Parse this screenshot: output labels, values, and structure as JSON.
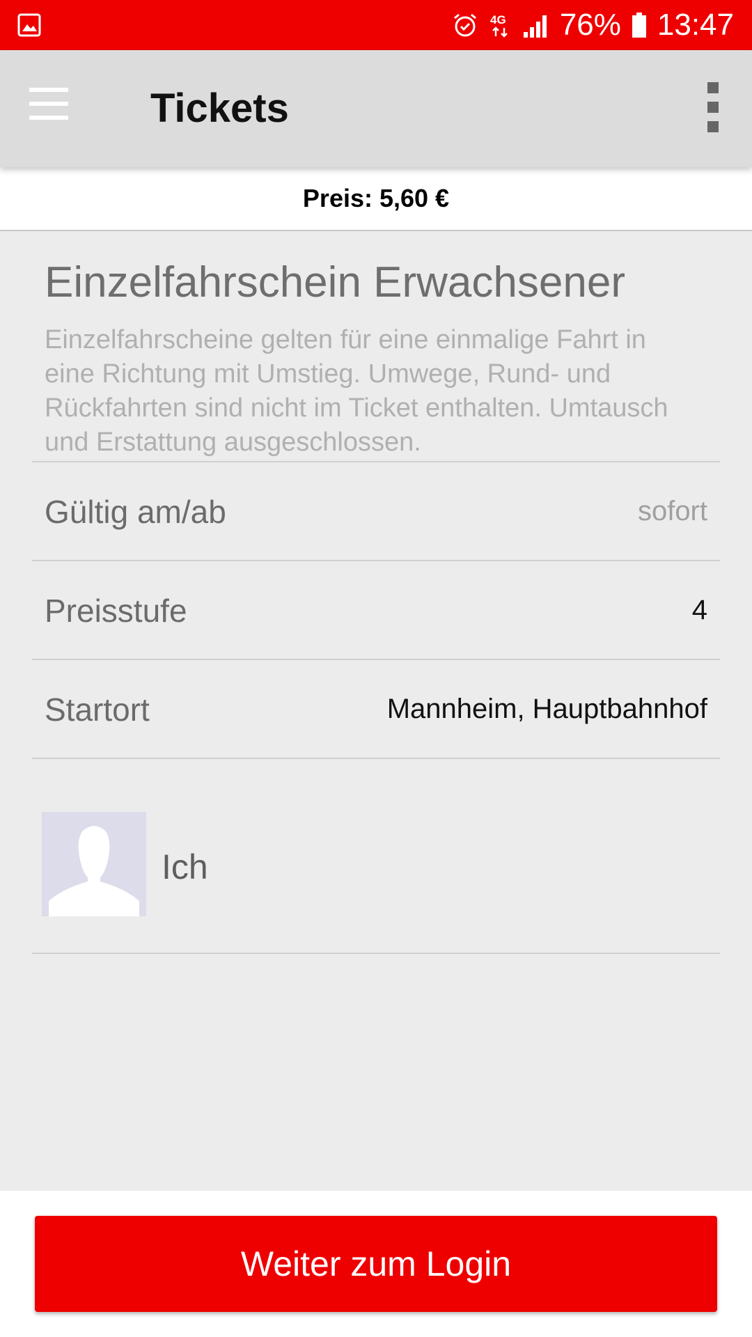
{
  "status_bar": {
    "battery_percent": "76%",
    "time": "13:47",
    "network": "4G",
    "icons": [
      "image-icon",
      "alarm-icon",
      "network-4g-icon",
      "signal-icon",
      "battery-icon"
    ]
  },
  "app_bar": {
    "title": "Tickets",
    "icons": [
      "hamburger-menu-icon",
      "overflow-menu-icon"
    ]
  },
  "price_bar": {
    "text": "Preis: 5,60 €"
  },
  "ticket": {
    "title": "Einzelfahrschein Erwachsener",
    "description": "Einzelfahrscheine gelten für eine einmalige Fahrt in eine Richtung mit Umstieg. Umwege, Rund- und Rückfahrten sind nicht im Ticket enthalten. Umtausch und Erstattung ausgeschlossen."
  },
  "rows": [
    {
      "label": "Gültig am/ab",
      "value": "sofort"
    },
    {
      "label": "Preisstufe",
      "value": "4"
    },
    {
      "label": "Startort",
      "value": "Mannheim, Hauptbahnhof"
    }
  ],
  "person": {
    "name": "Ich",
    "icon": "person-avatar-icon"
  },
  "footer": {
    "button_label": "Weiter zum Login"
  },
  "colors": {
    "accent_red": "#ee0000",
    "app_bar_bg": "#dcdcdc",
    "content_bg": "#ececec"
  }
}
